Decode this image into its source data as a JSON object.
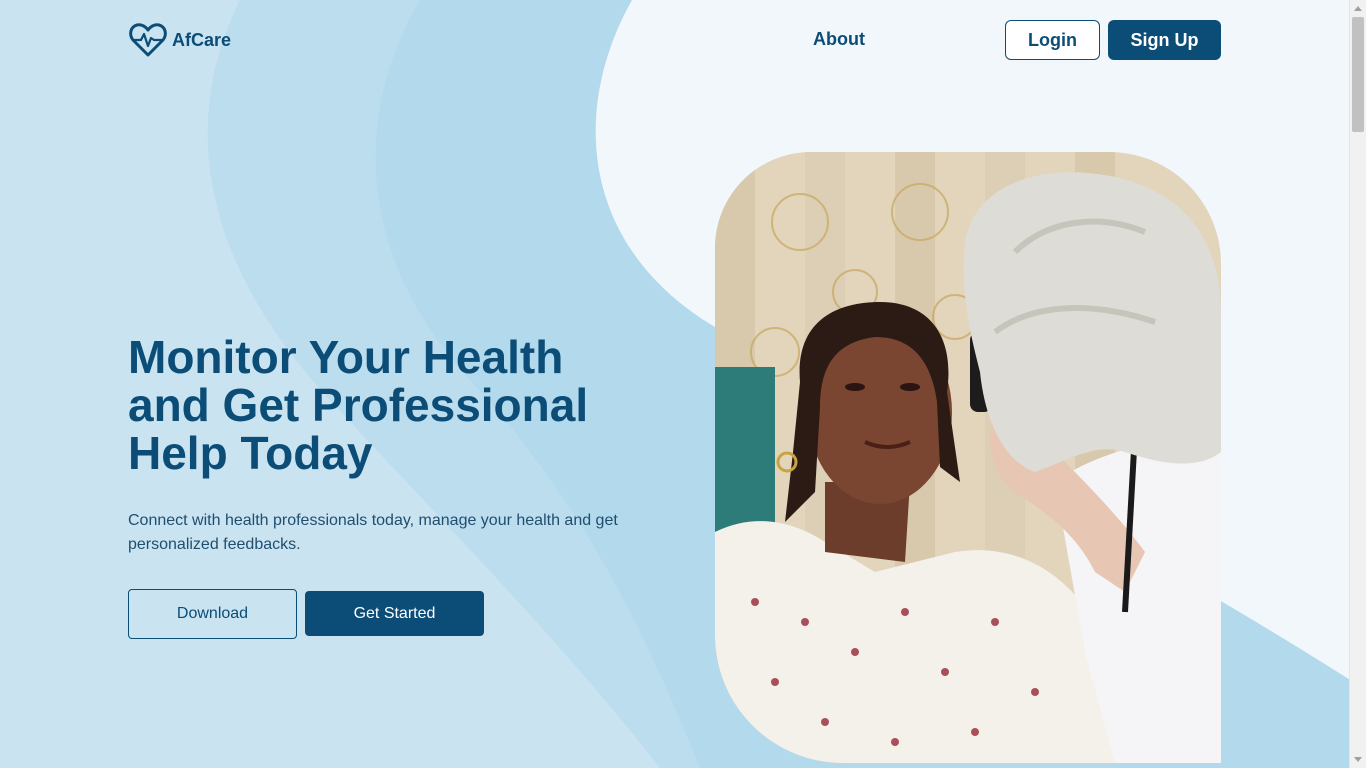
{
  "brand": {
    "name": "AfCare",
    "logo_icon": "heart-pulse-icon"
  },
  "nav": {
    "about": "About",
    "login": "Login",
    "signup": "Sign Up"
  },
  "hero": {
    "title_lines": [
      "Monitor Your Health",
      "and Get Professional",
      "Help Today"
    ],
    "subtitle": "Connect with health professionals today, manage your health and get personalized feedbacks.",
    "download_label": "Download",
    "get_started_label": "Get Started",
    "image_alt": "Doctor examining patient's eye"
  },
  "colors": {
    "primary": "#0b4d77",
    "background_light": "#c9e3f1",
    "background_wave": "#b3d9ec",
    "background_white": "#f2f7fc"
  }
}
